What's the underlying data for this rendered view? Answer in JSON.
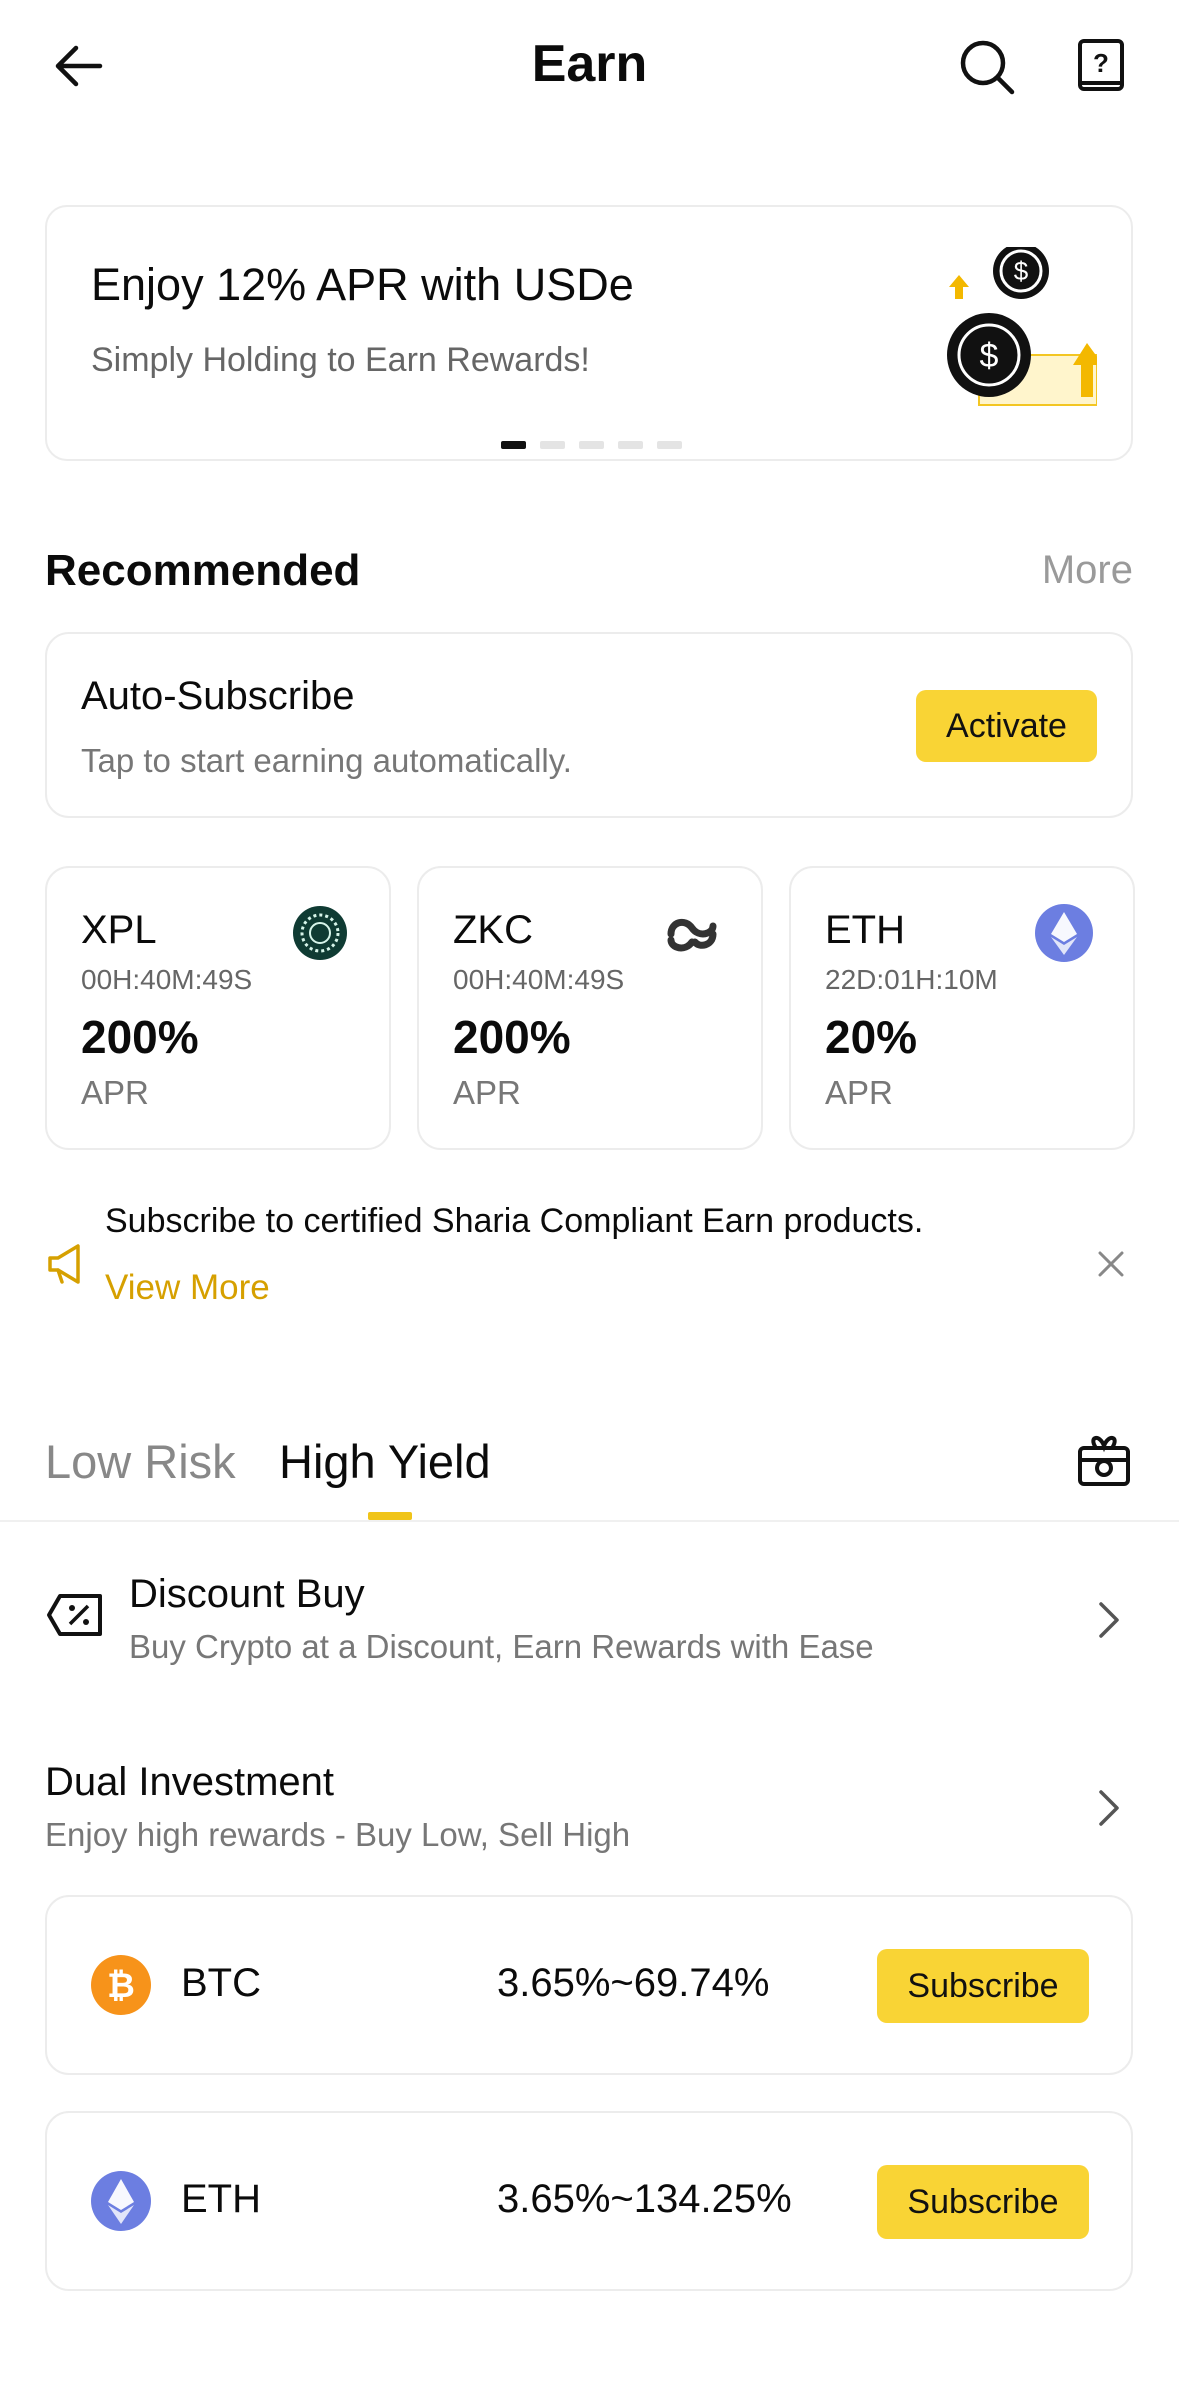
{
  "header": {
    "title": "Earn",
    "back_icon": "arrow-left-icon",
    "search_icon": "search-icon",
    "help_icon": "help-book-icon"
  },
  "banner": {
    "title": "Enjoy 12% APR with USDe",
    "subtitle": "Simply Holding to Earn Rewards!",
    "page_count": 5,
    "active_page": 1
  },
  "recommended": {
    "title": "Recommended",
    "more_label": "More",
    "auto_subscribe": {
      "title": "Auto-Subscribe",
      "subtitle": "Tap to start earning automatically.",
      "button_label": "Activate"
    },
    "products": [
      {
        "name": "XPL",
        "countdown": "00H:40M:49S",
        "apr": "200%",
        "apr_label": "APR",
        "icon": "xpl-logo-icon"
      },
      {
        "name": "ZKC",
        "countdown": "00H:40M:49S",
        "apr": "200%",
        "apr_label": "APR",
        "icon": "zkc-logo-icon"
      },
      {
        "name": "ETH",
        "countdown": "22D:01H:10M",
        "apr": "20%",
        "apr_label": "APR",
        "icon": "eth-logo-icon"
      }
    ]
  },
  "notice": {
    "text": "Subscribe to certified Sharia Compliant Earn products.",
    "link_label": "View More",
    "icon": "megaphone-icon"
  },
  "tabs": [
    {
      "label": "Low Risk",
      "active": false
    },
    {
      "label": "High Yield",
      "active": true
    }
  ],
  "list": {
    "discount_buy": {
      "title": "Discount Buy",
      "subtitle": "Buy Crypto at a Discount, Earn Rewards with Ease"
    },
    "dual_investment": {
      "title": "Dual Investment",
      "subtitle": "Enjoy high rewards - Buy Low, Sell High",
      "items": [
        {
          "coin": "BTC",
          "rate": "3.65%~69.74%",
          "button_label": "Subscribe"
        },
        {
          "coin": "ETH",
          "rate": "3.65%~134.25%",
          "button_label": "Subscribe"
        }
      ]
    }
  },
  "colors": {
    "accent": "#f9d435",
    "link": "#d6a000",
    "btc": "#f7931a",
    "eth": "#6c7ee1"
  }
}
